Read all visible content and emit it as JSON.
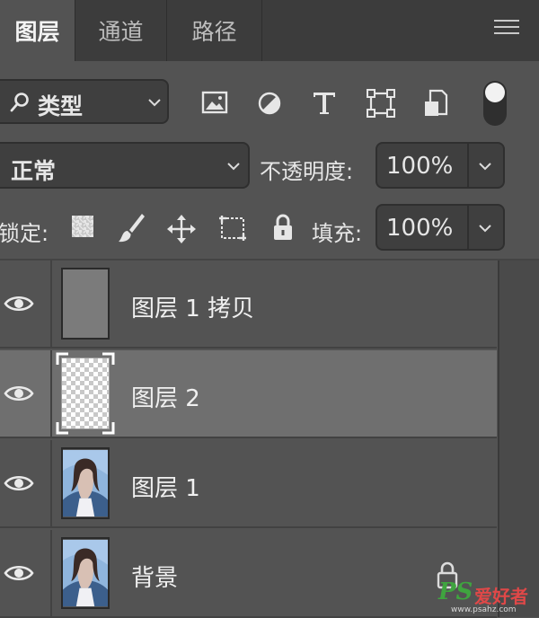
{
  "tabs": [
    {
      "label": "图层",
      "active": true
    },
    {
      "label": "通道",
      "active": false
    },
    {
      "label": "路径",
      "active": false
    }
  ],
  "filter": {
    "kind_label": "类型",
    "icons": [
      "image-filter-icon",
      "adjustment-filter-icon",
      "type-filter-icon",
      "shape-filter-icon",
      "smart-object-filter-icon"
    ]
  },
  "blend": {
    "mode": "正常",
    "opacity_label": "不透明度:",
    "opacity_value": "100%"
  },
  "lock": {
    "label": "锁定:",
    "fill_label": "填充:",
    "fill_value": "100%"
  },
  "layers": [
    {
      "name": "图层 1 拷贝",
      "visible": true,
      "selected": false,
      "thumb": "gray"
    },
    {
      "name": "图层 2",
      "visible": true,
      "selected": true,
      "thumb": "transparent"
    },
    {
      "name": "图层 1",
      "visible": true,
      "selected": false,
      "thumb": "photo"
    },
    {
      "name": "背景",
      "visible": true,
      "selected": false,
      "thumb": "photo",
      "locked": true
    }
  ],
  "watermark": {
    "logo": "PS",
    "text": "爱好者",
    "url": "www.psahz.com"
  },
  "colors": {
    "panel": "#535353",
    "tabbar": "#3c3c3c",
    "selected_row": "#6f6f6f",
    "field": "#3f3f3f"
  }
}
